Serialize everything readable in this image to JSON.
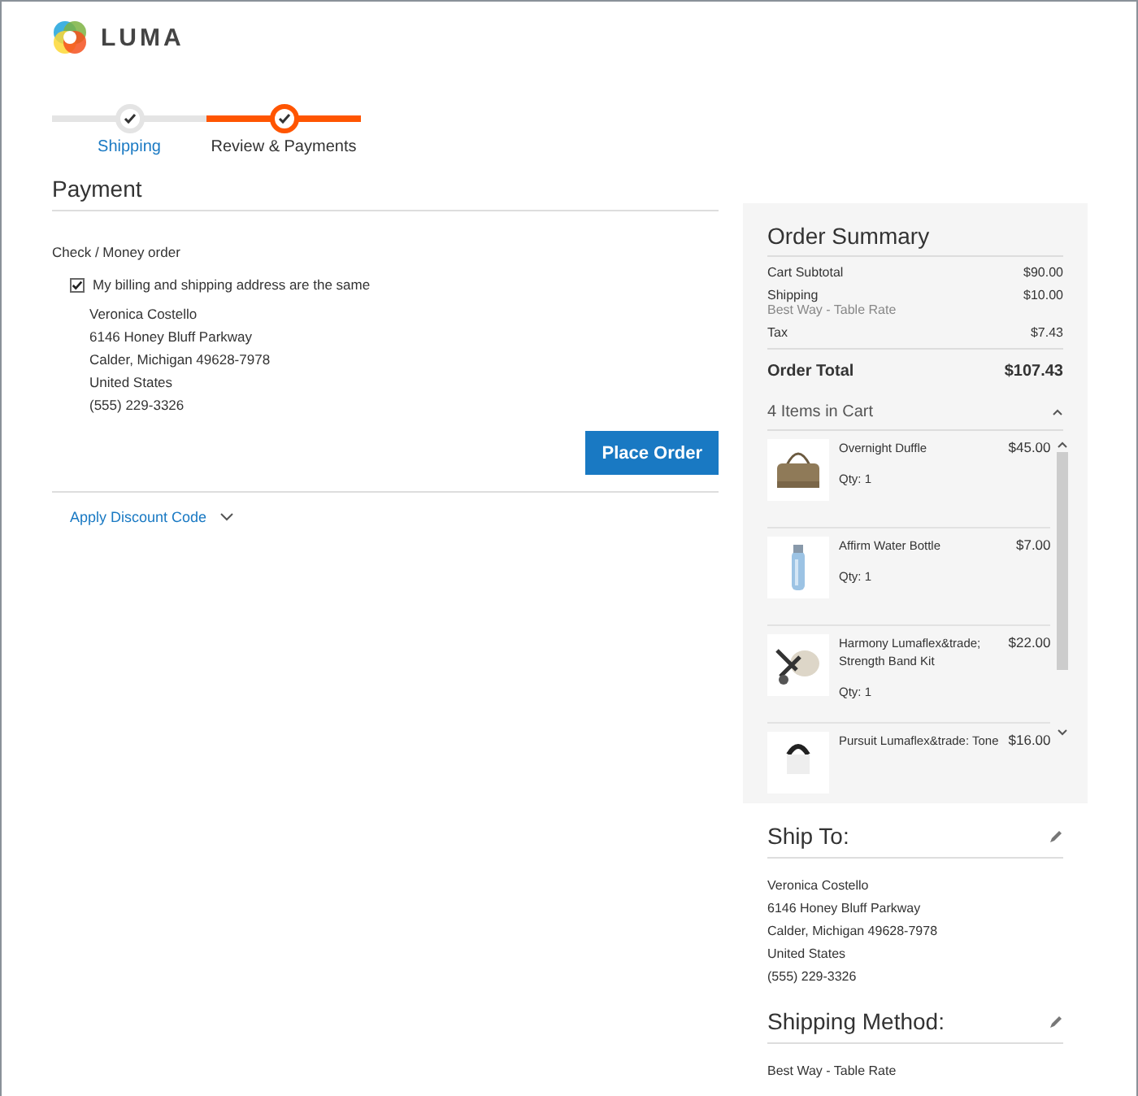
{
  "logo": {
    "text": "LUMA"
  },
  "steps": [
    {
      "label": "Shipping",
      "selected": false
    },
    {
      "label": "Review & Payments",
      "selected": true
    }
  ],
  "payment": {
    "title": "Payment",
    "method": "Check / Money order",
    "same_address": {
      "label": "My billing and shipping address are the same",
      "checked": true
    },
    "address": [
      "Veronica Costello",
      "6146 Honey Bluff Parkway",
      "Calder, Michigan 49628-7978",
      "United States",
      "(555) 229-3326"
    ],
    "button": "Place Order",
    "discount": "Apply Discount Code"
  },
  "summary": {
    "title": "Order Summary",
    "rows": [
      {
        "label": "Cart Subtotal",
        "value": "$90.00"
      },
      {
        "label": "Shipping",
        "sub": "Best Way - Table Rate",
        "value": "$10.00"
      },
      {
        "label": "Tax",
        "value": "$7.43"
      }
    ],
    "total": {
      "label": "Order Total",
      "value": "$107.43"
    },
    "cart": {
      "title": "4 Items in Cart",
      "expanded": true,
      "items": [
        {
          "name": "Overnight Duffle",
          "qty": "Qty: 1",
          "price": "$45.00",
          "kind": "bag"
        },
        {
          "name": "Affirm Water Bottle",
          "qty": "Qty: 1",
          "price": "$7.00",
          "kind": "bottle"
        },
        {
          "name": "Harmony Lumaflex&trade; Strength Band Kit",
          "qty": "Qty: 1",
          "price": "$22.00",
          "kind": "bands"
        },
        {
          "name": "Pursuit Lumaflex&trade: Tone",
          "price": "$16.00",
          "kind": "tone"
        }
      ]
    }
  },
  "ship_to": {
    "title": "Ship To:",
    "address": [
      "Veronica Costello",
      "6146 Honey Bluff Parkway",
      "Calder, Michigan 49628-7978",
      "United States",
      "(555) 229-3326"
    ]
  },
  "shipping_method": {
    "title": "Shipping Method:",
    "value": "Best Way - Table Rate"
  }
}
